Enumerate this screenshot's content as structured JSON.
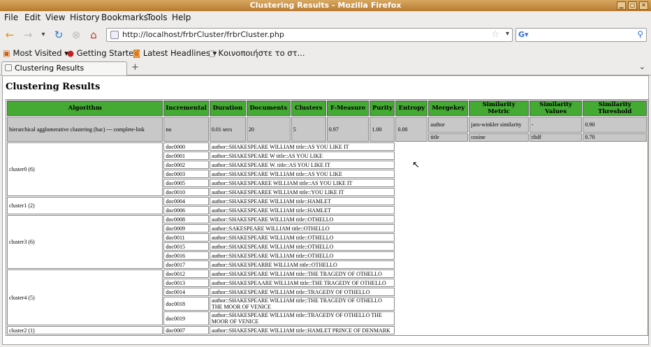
{
  "window": {
    "title": "Clustering Results - Mozilla Firefox"
  },
  "menus": [
    "File",
    "Edit",
    "View",
    "History",
    "Bookmarks",
    "Tools",
    "Help"
  ],
  "nav": {
    "url": "http://localhost/frbrCluster/frbrCluster.php"
  },
  "bookmarks": [
    "Most Visited",
    "Getting Started",
    "Latest Headlines",
    "Κοινοποιήστε το στ..."
  ],
  "tab": {
    "title": "Clustering Results"
  },
  "page": {
    "title": "Clustering Results"
  },
  "headers": [
    "Algorithm",
    "Incremental",
    "Duration",
    "Documents",
    "Clusters",
    "F-Measure",
    "Purity",
    "Entropy",
    "Mergekey",
    "Similarity Metric",
    "Similarity Values",
    "Similarity Threshold"
  ],
  "summary": {
    "algorithm": "hierarchical agglomerative clustering (hac) --- complete-link",
    "incremental": "no",
    "duration": "0.01 secs",
    "documents": "20",
    "clusters": "5",
    "fmeasure": "0.97",
    "purity": "1.00",
    "entropy": "0.00",
    "merge": [
      {
        "key": "author",
        "metric": "jaro-winkler similarity",
        "values": "-",
        "threshold": "0.90"
      },
      {
        "key": "title",
        "metric": "cosine",
        "values": "tfidf",
        "threshold": "0.70"
      }
    ]
  },
  "clusters": [
    {
      "name": "cluster0 (6)",
      "docs": [
        [
          "doc0000",
          "author::SHAKESPEARE WILLIAM title::AS YOU LIKE IT"
        ],
        [
          "doc0001",
          "author::SHAKESPEARE W title::AS YOU LIKE"
        ],
        [
          "doc0002",
          "author::SHAKESPEARE W. title::AS YOU LIKE IT"
        ],
        [
          "doc0003",
          "author::SHAKESPEARE WILLIAM title::AS YOU LIKE"
        ],
        [
          "doc0005",
          "author::SHAKESPEAREE WILLIAM title::AS YOU LIKE IT"
        ],
        [
          "doc0010",
          "author::SHAKESPEAREE WILLIAM title::YOU LIKE IT"
        ]
      ]
    },
    {
      "name": "cluster1 (2)",
      "docs": [
        [
          "doc0004",
          "author::SHAKESPEARE WILLIAM title::HAMLET"
        ],
        [
          "doc0006",
          "author::SHAKESPEARE WILLIAM title::HAMLET"
        ]
      ]
    },
    {
      "name": "cluster3 (6)",
      "docs": [
        [
          "doc0008",
          "author::SHAKESPEARE WILLIAM title::OTHELLO"
        ],
        [
          "doc0009",
          "author::SAKESPEARE WILLIAM title::OTHELLO"
        ],
        [
          "doc0011",
          "author::SHAKESPEARE WILLIAM title::OTHELLO"
        ],
        [
          "doc0015",
          "author::SHAKESPEARE WILLIAM title::OTHELLO"
        ],
        [
          "doc0016",
          "author::SHAKESPEARE WILLIAM title::OTHELLO"
        ],
        [
          "doc0017",
          "author::SHAKESPEARRE WILLIAM title::OTHELLO"
        ]
      ]
    },
    {
      "name": "cluster4 (5)",
      "docs": [
        [
          "doc0012",
          "author::SHAKESPEARE WILLIAM title::THE TRAGEDY OF OTHELLO"
        ],
        [
          "doc0013",
          "author::SHAKESPEAARE WILLIAM title::THE TRAGEDY OF OTHELLO"
        ],
        [
          "doc0014",
          "author::SHAKESPEARE WILLIAM title::TRAGEDY OF OTHELLO"
        ],
        [
          "doc0018",
          "author::SHAKESPEARE WILLIAM title::THE TRAGEDY OF OTHELLO THE MOOR OF VENICE"
        ],
        [
          "doc0019",
          "author::SHAKESPEARE WILLIAM title::TRAGEDY OF OTHELLO THE MOOR OF VENICE"
        ]
      ]
    },
    {
      "name": "cluster2 (1)",
      "docs": [
        [
          "doc0007",
          "author::SHAKESPEARE WILLIAM title::HAMLET PRINCE OF DENMARK"
        ]
      ]
    }
  ]
}
